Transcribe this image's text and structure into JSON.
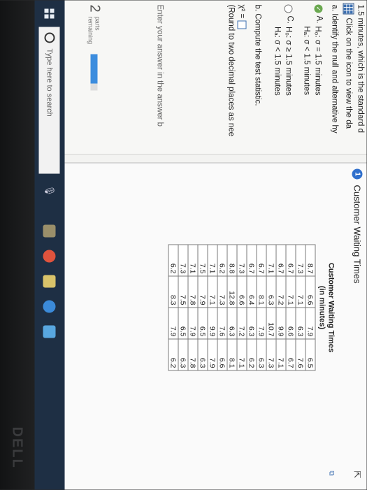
{
  "question": {
    "header_line": "1.5 minutes, which is the standard d",
    "data_link_text": "Click on the icon to view the da",
    "part_a": "a. Identify the null and alternative hy",
    "options": [
      {
        "letter": "A.",
        "h0": "H₀: σ = 1.5 minutes",
        "ha": "Hₐ: σ < 1.5 minutes",
        "selected": true
      },
      {
        "letter": "C.",
        "h0": "H₀: σ ≥ 1.5 minutes",
        "ha": "Hₐ: σ < 1.5 minutes",
        "selected": false
      }
    ],
    "part_b": "b. Compute the test statistic.",
    "chi_label": "χ² =",
    "round_note": "(Round to two decimal places as nee",
    "enter_answer": "Enter your answer in the answer b",
    "parts_count": "2",
    "parts_label_1": "parts",
    "parts_label_2": "remaining",
    "progress_fraction": 0.82
  },
  "popup": {
    "info_number": "1",
    "title": "Customer Waiting Times",
    "table_caption_1": "Customer Waiting Times",
    "table_caption_2": "(in minutes)",
    "rows": [
      [
        "8.7",
        "6.6",
        "7.9",
        "6.5"
      ],
      [
        "7.3",
        "7.1",
        "6.3",
        "7.6"
      ],
      [
        "6.7",
        "7.1",
        "6.6",
        "6.7"
      ],
      [
        "6.7",
        "7.2",
        "9.9",
        "7.1"
      ],
      [
        "7.1",
        "6.3",
        "10.7",
        "7.3"
      ],
      [
        "6.7",
        "8.1",
        "7.9",
        "6.3"
      ],
      [
        "6.7",
        "6.4",
        "6.3",
        "6.2"
      ],
      [
        "7.3",
        "6.6",
        "7.2",
        "7.1"
      ],
      [
        "8.8",
        "12.8",
        "6.3",
        "8.1"
      ],
      [
        "6.2",
        "7.3",
        "7.6",
        "6.6"
      ],
      [
        "7.1",
        "7.1",
        "9.9",
        "7.9"
      ],
      [
        "7.5",
        "7.9",
        "6.5",
        "6.3"
      ],
      [
        "7.1",
        "7.8",
        "7.9",
        "7.8"
      ],
      [
        "7.3",
        "7.5",
        "6.5",
        "6.3"
      ],
      [
        "6.2",
        "8.3",
        "7.9",
        "6.2"
      ]
    ]
  },
  "taskbar": {
    "search_placeholder": "Type here to search"
  },
  "monitor": {
    "brand": "DELL"
  },
  "icons": {
    "data_icon": "grid-icon",
    "info": "info-icon",
    "check": "check-icon",
    "windows": "windows-start-icon"
  },
  "colors": {
    "accent": "#3c6fb0",
    "taskbar": "#1e2f44",
    "correct": "#6aa84f"
  }
}
